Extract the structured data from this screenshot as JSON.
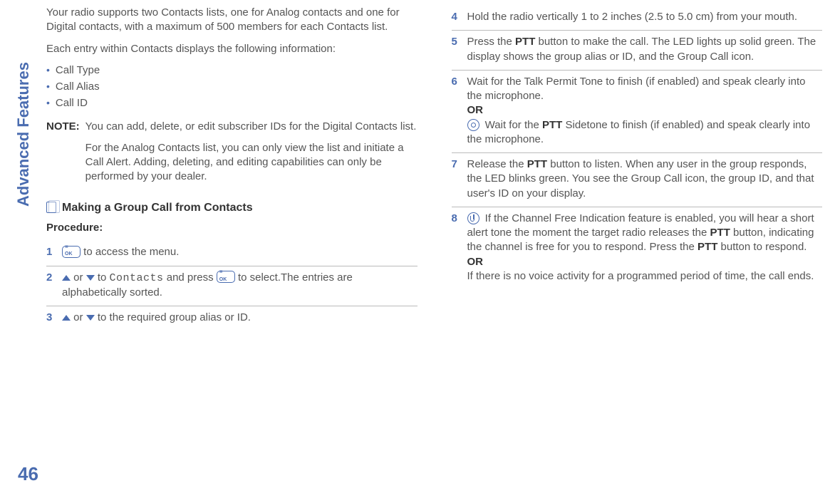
{
  "side_label": "Advanced Features",
  "page_number": "46",
  "left": {
    "intro1": "Your radio supports two Contacts lists, one for Analog contacts and one for Digital contacts, with a maximum of 500 members for each Contacts list.",
    "intro2": "Each entry within Contacts displays the following information:",
    "bullets": [
      "Call Type",
      "Call Alias",
      "Call ID"
    ],
    "note_label": "NOTE:",
    "note_p1": "You can add, delete, or edit subscriber IDs for the Digital Contacts list.",
    "note_p2": "For the Analog Contacts list, you can only view the list and initiate a Call Alert. Adding, deleting, and editing capabilities can only be performed by your dealer.",
    "section_title": "Making a Group Call from Contacts",
    "procedure_label": "Procedure:",
    "step1_tail": " to access the menu.",
    "step2_a": " or ",
    "step2_b": " to ",
    "step2_contacts": "Contacts",
    "step2_c": " and press ",
    "step2_d": " to select.The entries are alphabetically sorted.",
    "step3_a": " or ",
    "step3_b": " to the required group alias or ID."
  },
  "right": {
    "step4": "Hold the radio vertically 1 to 2 inches (2.5 to 5.0 cm) from your mouth.",
    "step5_a": "Press the ",
    "step5_ptt": "PTT",
    "step5_b": " button to make the call. The LED lights up solid green. The display shows the group alias or ID, and the Group Call icon.",
    "step6_a": "Wait for the Talk Permit Tone to finish (if enabled) and speak clearly into the microphone.",
    "or": "OR",
    "step6_b1": " Wait for the ",
    "step6_ptt": "PTT",
    "step6_b2": " Sidetone to finish (if enabled) and speak clearly into the microphone.",
    "step7_a": "Release the ",
    "step7_ptt": "PTT",
    "step7_b": " button to listen. When any user in the group responds, the LED blinks green. You see the Group Call icon, the group ID, and that user's ID on your display.",
    "step8_a": " If the Channel Free Indication feature is enabled, you will hear a short alert tone the moment the target radio releases the ",
    "step8_ptt1": "PTT",
    "step8_b": " button, indicating the channel is free for you to respond. Press the ",
    "step8_ptt2": "PTT",
    "step8_c": " button to respond.",
    "step8_d": "If there is no voice activity for a programmed period of time, the call ends.",
    "nums": {
      "s4": "4",
      "s5": "5",
      "s6": "6",
      "s7": "7",
      "s8": "8"
    },
    "lnums": {
      "s1": "1",
      "s2": "2",
      "s3": "3"
    }
  }
}
